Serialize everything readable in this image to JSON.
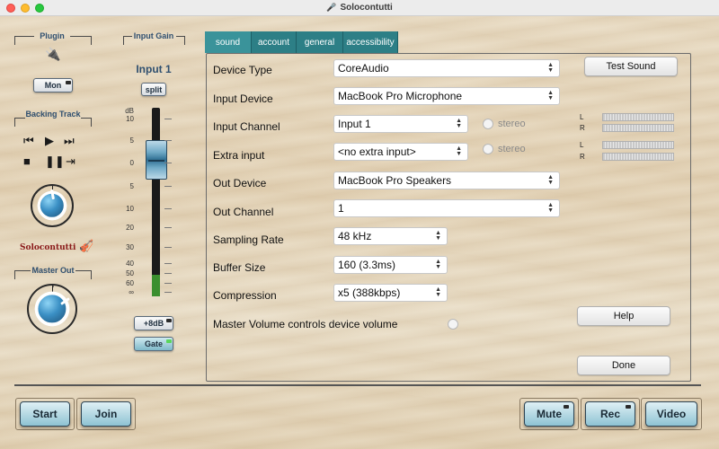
{
  "window": {
    "title": "Solocontutti"
  },
  "left": {
    "plugin_label": "Plugin",
    "mon_label": "Mon",
    "backing_label": "Backing Track",
    "logo_text": "Solocontutti",
    "master_label": "Master Out"
  },
  "gain": {
    "label": "Input Gain",
    "channel": "Input 1",
    "split_label": "split",
    "scale": [
      "dB",
      "10",
      "5",
      "0",
      "5",
      "10",
      "20",
      "30",
      "40",
      "50",
      "60",
      "∞"
    ],
    "plus8_label": "+8dB",
    "gate_label": "Gate"
  },
  "tabs": [
    "sound",
    "account",
    "general",
    "accessibility"
  ],
  "settings": {
    "device_type": {
      "label": "Device Type",
      "value": "CoreAudio"
    },
    "input_device": {
      "label": "Input Device",
      "value": "MacBook Pro Microphone"
    },
    "input_channel": {
      "label": "Input Channel",
      "value": "Input 1",
      "stereo": "stereo"
    },
    "extra_input": {
      "label": "Extra input",
      "value": "<no extra input>",
      "stereo": "stereo"
    },
    "out_device": {
      "label": "Out Device",
      "value": "MacBook Pro Speakers"
    },
    "out_channel": {
      "label": "Out Channel",
      "value": "1"
    },
    "sampling_rate": {
      "label": "Sampling Rate",
      "value": "48 kHz"
    },
    "buffer_size": {
      "label": "Buffer Size",
      "value": "160 (3.3ms)"
    },
    "compression": {
      "label": "Compression",
      "value": "x5 (388kbps)"
    },
    "master_volume": {
      "label": "Master Volume controls device volume"
    }
  },
  "meters": {
    "l": "L",
    "r": "R"
  },
  "buttons": {
    "test_sound": "Test Sound",
    "help": "Help",
    "done": "Done"
  },
  "bottom": {
    "start": "Start",
    "join": "Join",
    "mute": "Mute",
    "rec": "Rec",
    "video": "Video"
  },
  "colors": {
    "tab": "#2d7f86",
    "knob": "#3a8fc4",
    "fader_green": "#3b8f2e"
  }
}
